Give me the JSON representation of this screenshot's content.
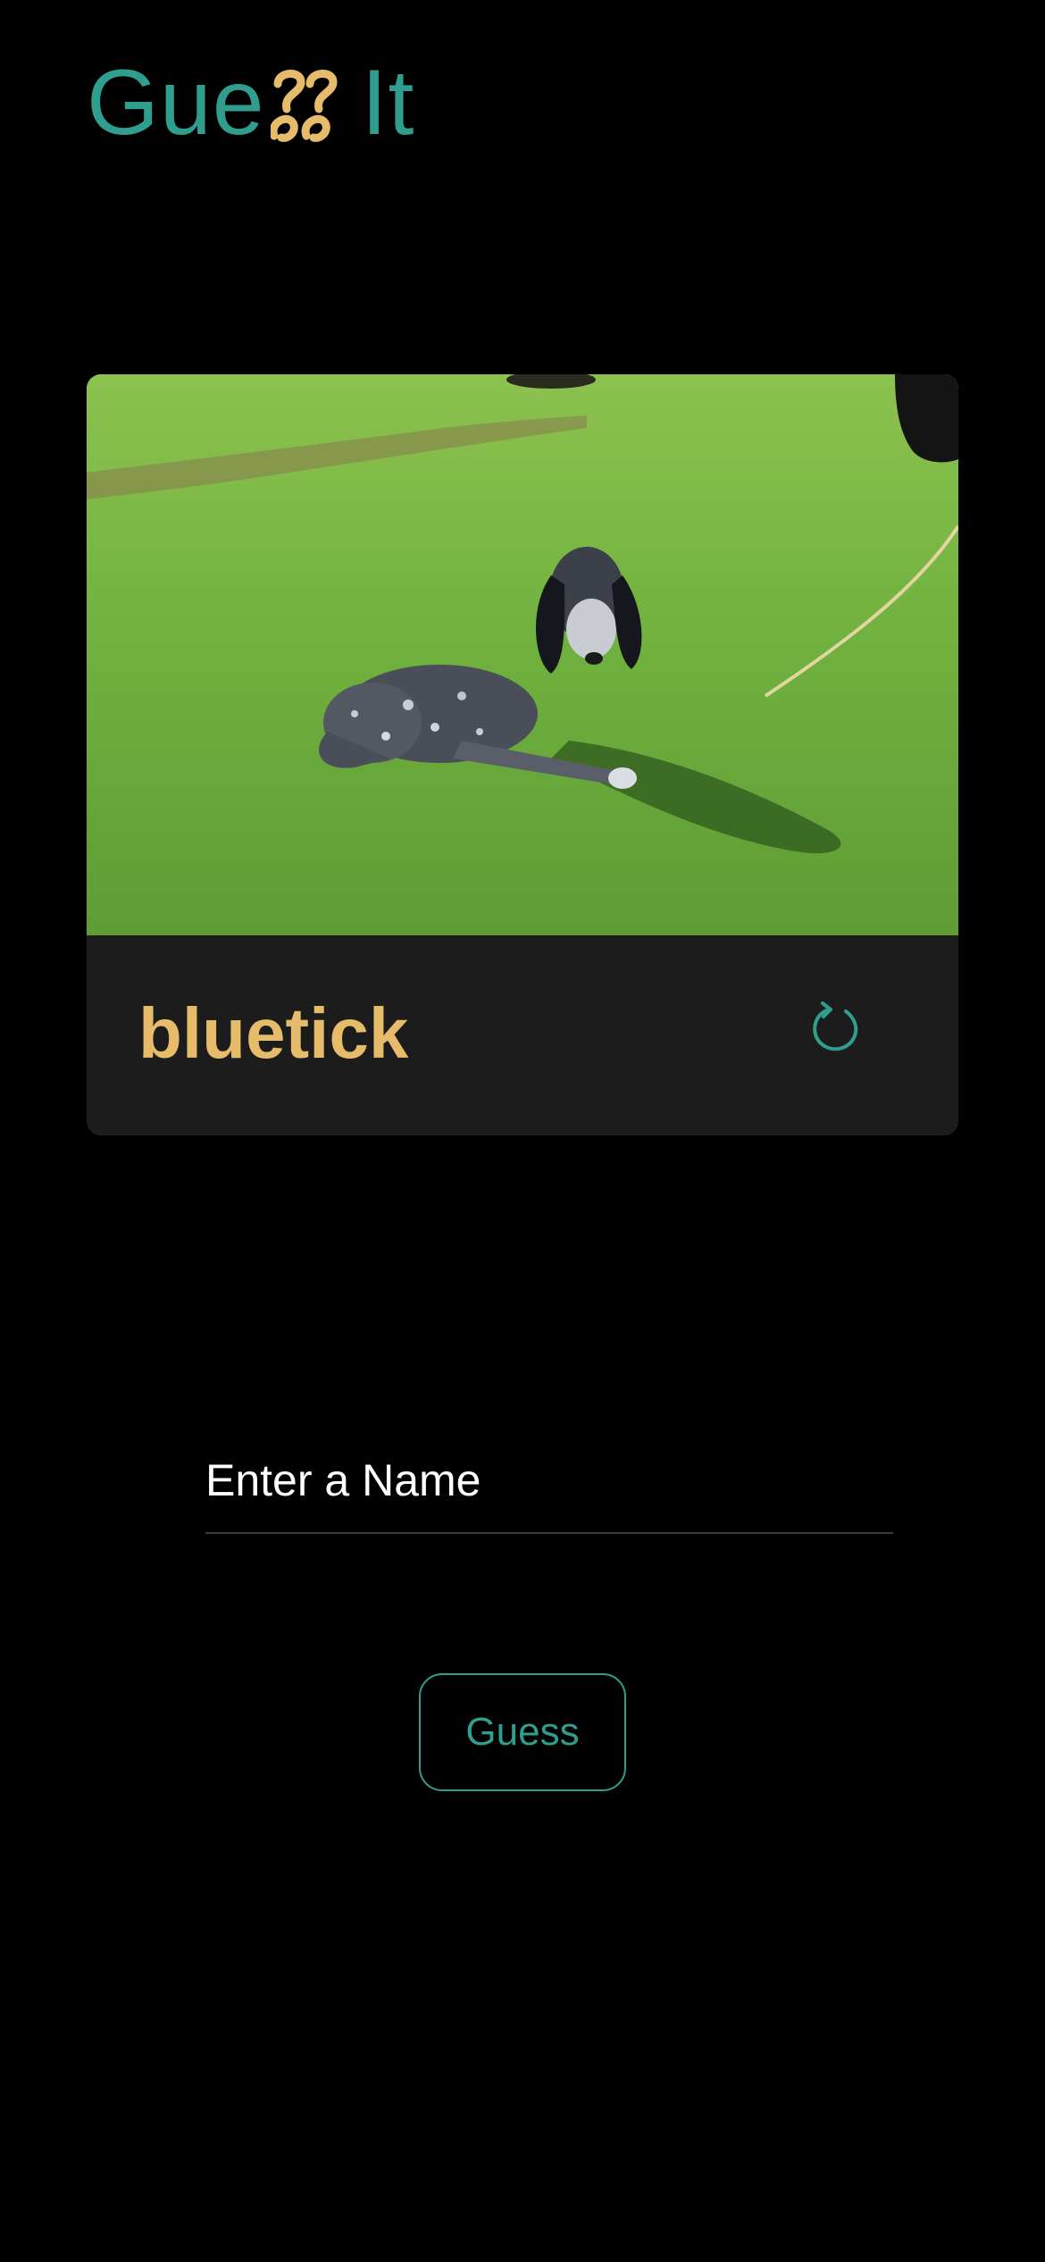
{
  "header": {
    "title_prefix": "Gue",
    "title_suffix": "It",
    "logo_icon": "double-question-mark-logo-icon"
  },
  "card": {
    "photo_alt": "bluetick",
    "breed_name": "bluetick",
    "refresh_icon": "refresh-icon"
  },
  "form": {
    "name_placeholder": "Enter a Name",
    "name_value": "",
    "guess_label": "Guess"
  },
  "colors": {
    "background": "#000000",
    "accent_teal": "#2f9e8e",
    "accent_gold": "#e6bb6a",
    "card_background": "#1c1c1c"
  }
}
